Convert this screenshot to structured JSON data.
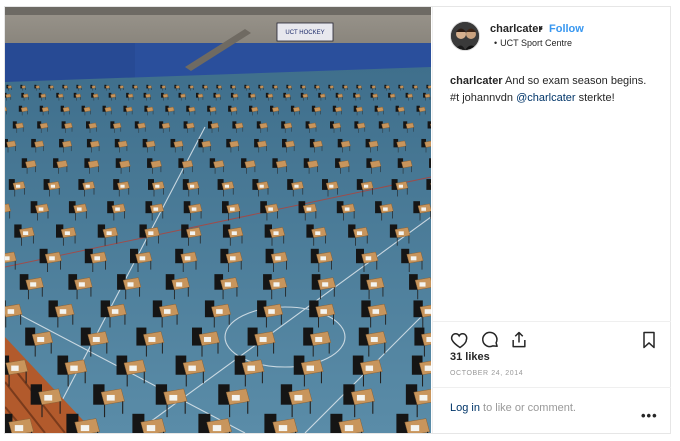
{
  "post": {
    "username": "charlcater",
    "separator": "•",
    "follow_label": "Follow",
    "location_bullet": "•",
    "location": "UCT Sport Centre",
    "caption": {
      "username": "charlcater",
      "text": " And so exam season begins. #t johannvdn ",
      "mention": "@charlcater",
      "tail": " sterkte!"
    },
    "likes": "31 likes",
    "date": "OCTOBER 24, 2014",
    "login": {
      "link": "Log in",
      "rest": " to like or comment."
    },
    "more": "•••"
  },
  "photo": {
    "banner_text": "UCT HOCKEY",
    "floor_color": "#4b7d99"
  },
  "icons": {
    "like": "heart-icon",
    "comment": "comment-icon",
    "share": "share-icon",
    "save": "bookmark-icon",
    "more": "more-options-icon"
  }
}
